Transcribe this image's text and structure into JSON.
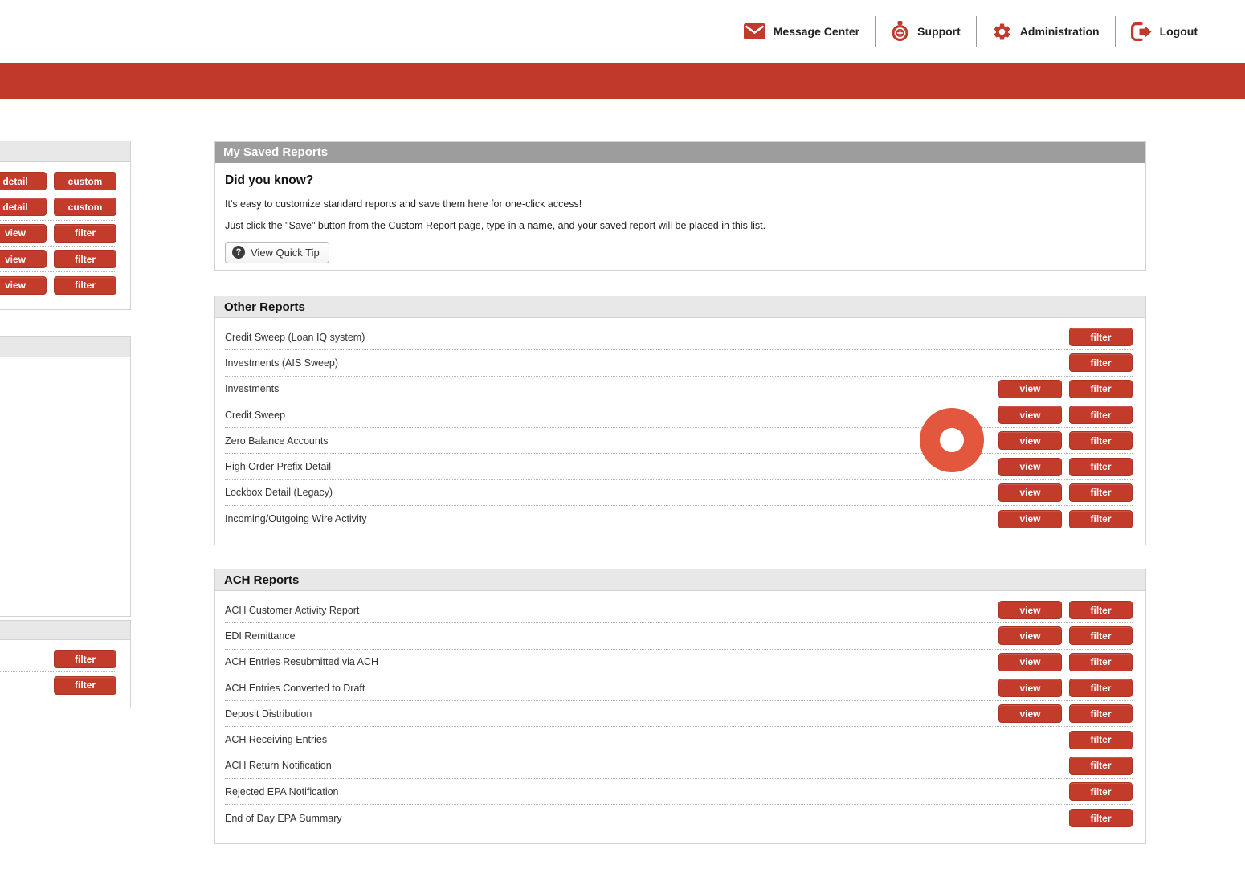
{
  "colors": {
    "accent": "#c0392b",
    "button": "#c23b2b",
    "cursor_ring": "#e2573d",
    "header_dark": "#9d9d9d",
    "header_light": "#e8e8e8"
  },
  "nav": {
    "items": [
      {
        "label": "Message Center",
        "icon": "envelope"
      },
      {
        "label": "Support",
        "icon": "life-buoy"
      },
      {
        "label": "Administration",
        "icon": "gear"
      },
      {
        "label": "Logout",
        "icon": "logout"
      }
    ]
  },
  "labels": {
    "view": "view",
    "filter": "filter",
    "detail": "detail",
    "custom": "custom"
  },
  "sidebar": {
    "panel1_rows": [
      [
        "detail",
        "custom"
      ],
      [
        "detail",
        "custom"
      ],
      [
        "view",
        "filter"
      ],
      [
        "view",
        "filter"
      ],
      [
        "view",
        "filter"
      ]
    ],
    "panel3_rows": [
      [
        null,
        "filter"
      ],
      [
        null,
        "filter"
      ]
    ]
  },
  "saved_reports": {
    "title": "My Saved Reports",
    "heading": "Did you know?",
    "line1": "It's easy to customize standard reports and save them here for one-click access!",
    "line2": "Just click the \"Save\" button from the Custom Report page, type in a name, and your saved report will be placed in this list.",
    "quick_tip_label": "View Quick Tip"
  },
  "other_reports": {
    "title": "Other Reports",
    "items": [
      {
        "name": "Credit Sweep (Loan IQ system)",
        "view": false,
        "filter": true
      },
      {
        "name": "Investments (AIS Sweep)",
        "view": false,
        "filter": true
      },
      {
        "name": "Investments",
        "view": true,
        "filter": true
      },
      {
        "name": "Credit Sweep",
        "view": true,
        "filter": true
      },
      {
        "name": "Zero Balance Accounts",
        "view": true,
        "filter": true
      },
      {
        "name": "High Order Prefix Detail",
        "view": true,
        "filter": true
      },
      {
        "name": "Lockbox Detail (Legacy)",
        "view": true,
        "filter": true
      },
      {
        "name": "Incoming/Outgoing Wire Activity",
        "view": true,
        "filter": true
      }
    ]
  },
  "ach_reports": {
    "title": "ACH Reports",
    "items": [
      {
        "name": "ACH Customer Activity Report",
        "view": true,
        "filter": true
      },
      {
        "name": "EDI Remittance",
        "view": true,
        "filter": true
      },
      {
        "name": "ACH Entries Resubmitted via ACH",
        "view": true,
        "filter": true
      },
      {
        "name": "ACH Entries Converted to Draft",
        "view": true,
        "filter": true
      },
      {
        "name": "Deposit Distribution",
        "view": true,
        "filter": true
      },
      {
        "name": "ACH Receiving Entries",
        "view": false,
        "filter": true
      },
      {
        "name": "ACH Return Notification",
        "view": false,
        "filter": true
      },
      {
        "name": "Rejected EPA Notification",
        "view": false,
        "filter": true
      },
      {
        "name": "End of Day EPA Summary",
        "view": false,
        "filter": true
      }
    ]
  }
}
